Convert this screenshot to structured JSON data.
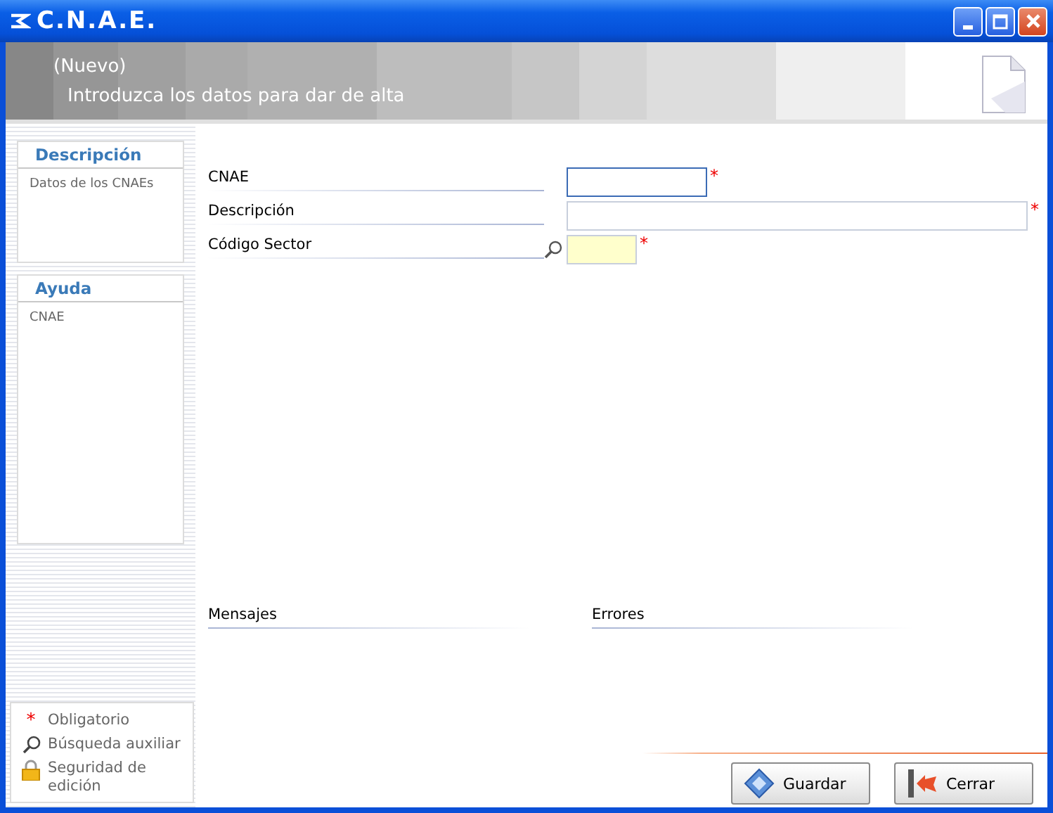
{
  "window": {
    "title": "C.N.A.E."
  },
  "header": {
    "mode": "(Nuevo)",
    "subtitle": "Introduzca los datos para dar de alta"
  },
  "sidebar": {
    "panels": [
      {
        "title": "Descripción",
        "text": "Datos de los CNAEs",
        "kind": "short"
      },
      {
        "title": "Ayuda",
        "text": "CNAE",
        "kind": "tall"
      }
    ],
    "legend": [
      {
        "kind": "required",
        "mark": "*",
        "text": "Obligatorio"
      },
      {
        "kind": "lookup",
        "text": "Búsqueda auxiliar"
      },
      {
        "kind": "lock",
        "text": "Seguridad de edición"
      }
    ]
  },
  "form": {
    "fields": [
      {
        "label": "CNAE",
        "kind": "code",
        "focused": true,
        "required": true,
        "mark": "*"
      },
      {
        "label": "Descripción",
        "kind": "text",
        "focused": false,
        "required": true,
        "mark": "*"
      },
      {
        "label": "Código Sector",
        "kind": "lookup",
        "focused": false,
        "required": true,
        "mark": "*"
      }
    ]
  },
  "sections": [
    "Mensajes",
    "Errores"
  ],
  "buttons": [
    {
      "label": "Guardar",
      "kind": "save"
    },
    {
      "label": "Cerrar",
      "kind": "close"
    }
  ]
}
